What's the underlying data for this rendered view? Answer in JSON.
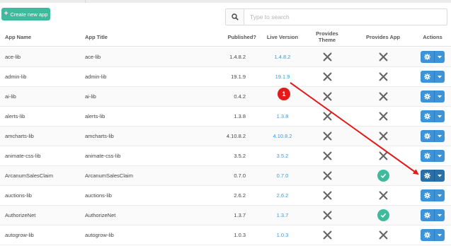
{
  "toolbar": {
    "create_label": "Create new app",
    "search_placeholder": "Type to search"
  },
  "columns": {
    "name": "App Name",
    "title": "App Title",
    "published": "Published?",
    "live": "Live Version",
    "theme_l1": "Provides",
    "theme_l2": "Theme",
    "app": "Provides App",
    "actions": "Actions"
  },
  "rows": [
    {
      "name": "ace-lib",
      "title": "ace-lib",
      "published": "1.4.8.2",
      "live": "1.4.8.2",
      "theme": false,
      "app": false
    },
    {
      "name": "admin-lib",
      "title": "admin-lib",
      "published": "19.1.9",
      "live": "19.1.9",
      "theme": false,
      "app": false
    },
    {
      "name": "ai-lib",
      "title": "ai-lib",
      "published": "0.4.2",
      "live": "",
      "theme": false,
      "app": false
    },
    {
      "name": "alerts-lib",
      "title": "alerts-lib",
      "published": "1.3.8",
      "live": "1.3.8",
      "theme": false,
      "app": false
    },
    {
      "name": "amcharts-lib",
      "title": "amcharts-lib",
      "published": "4.10.8.2",
      "live": "4.10.8.2",
      "theme": false,
      "app": false
    },
    {
      "name": "animate-css-lib",
      "title": "animate-css-lib",
      "published": "3.5.2",
      "live": "3.5.2",
      "theme": false,
      "app": false
    },
    {
      "name": "ArcanumSalesClaim",
      "title": "ArcanumSalesClaim",
      "published": "0.7.0",
      "live": "0.7.0",
      "theme": false,
      "app": true
    },
    {
      "name": "auctions-lib",
      "title": "auctions-lib",
      "published": "2.6.2",
      "live": "2.6.2",
      "theme": false,
      "app": false
    },
    {
      "name": "AuthorizeNet",
      "title": "AuthorizeNet",
      "published": "1.3.7",
      "live": "1.3.7",
      "theme": false,
      "app": true
    },
    {
      "name": "autogrow-lib",
      "title": "autogrow-lib",
      "published": "1.0.3",
      "live": "1.0.3",
      "theme": false,
      "app": false
    }
  ],
  "annotation": {
    "badge": "1",
    "color": "#e21a1a"
  },
  "colors": {
    "accent": "#3dbb9c",
    "link": "#3a9bd5",
    "action": "#3d93d5",
    "mark": "#666666"
  }
}
